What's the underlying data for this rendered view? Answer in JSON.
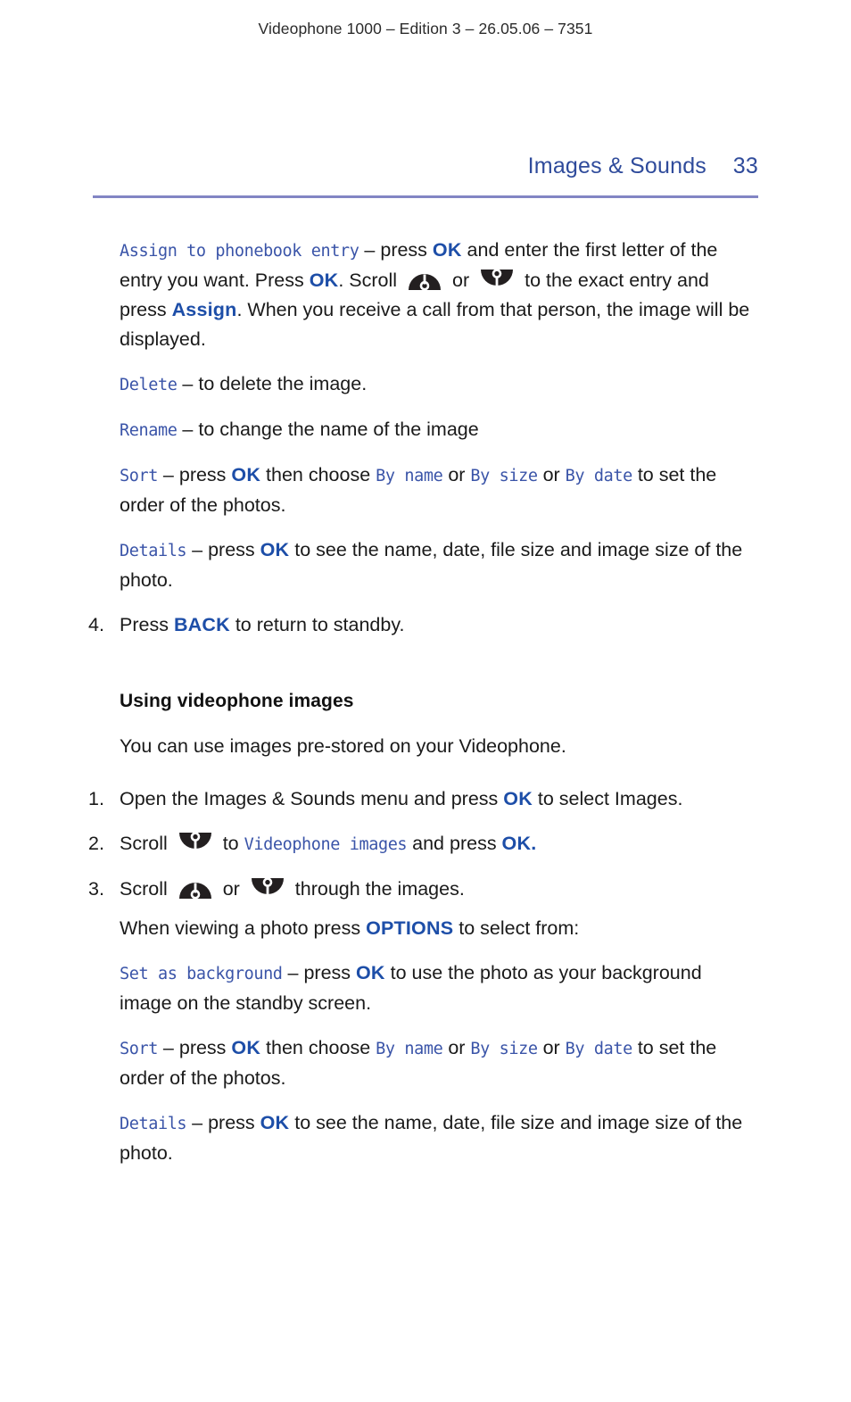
{
  "document": {
    "running_header": "Videophone 1000 – Edition 3 – 26.05.06 – 7351",
    "section_title": "Images & Sounds",
    "page_number": "33"
  },
  "colors": {
    "heading_blue": "#2f4b9b",
    "rule_blue": "#8285c4",
    "key_blue": "#1d4ea8",
    "lcd_blue": "#3a54a8",
    "body_text": "#1a1a1a"
  },
  "icons": {
    "scroll_up": "scroll-up-icon",
    "scroll_down": "scroll-down-icon"
  },
  "body": {
    "assign_entry": {
      "menu_label": "Assign to phonebook entry",
      "t1": " – press ",
      "key1": "OK",
      "t2": " and enter the first letter of the entry you want. Press ",
      "key2": "OK",
      "t3": ". Scroll ",
      "t4": " or ",
      "t5": " to the exact entry and press ",
      "key3": "Assign",
      "t6": ". When you receive a call from that person, the image will be displayed."
    },
    "delete": {
      "menu_label": "Delete",
      "t1": " – to delete the image."
    },
    "rename": {
      "menu_label": "Rename",
      "t1": " – to change the name of the image"
    },
    "sort_1": {
      "menu_label": "Sort",
      "t1": " – press ",
      "key1": "OK",
      "t2": " then choose ",
      "opt1": "By name",
      "t3": " or ",
      "opt2": "By size",
      "t4": " or ",
      "opt3": "By date",
      "t5": " to set the order of the photos."
    },
    "details_1": {
      "menu_label": "Details",
      "t1": " – press ",
      "key1": "OK",
      "t2": " to see the name, date, file size and image size of the photo."
    },
    "step4": {
      "number": "4.",
      "t1": "Press ",
      "key1": "BACK",
      "t2": " to return to standby."
    },
    "subheading": "Using videophone images",
    "intro": "You can use images pre-stored on your Videophone.",
    "step1": {
      "number": "1.",
      "t1": "Open the Images & Sounds menu and press ",
      "key1": "OK",
      "t2": " to select Images."
    },
    "step2": {
      "number": "2.",
      "t1": "Scroll ",
      "t2": " to ",
      "menu_label": "Videophone images",
      "t3": " and press ",
      "key1": "OK."
    },
    "step3": {
      "number": "3.",
      "t1": "Scroll ",
      "t2": " or ",
      "t3": " through the images."
    },
    "options_intro": {
      "t1": "When viewing a photo press ",
      "key1": "OPTIONS",
      "t2": " to select from:"
    },
    "set_background": {
      "menu_label": "Set as background",
      "t1": " – press ",
      "key1": "OK",
      "t2": " to use the photo as your background image on the standby screen."
    },
    "sort_2": {
      "menu_label": "Sort",
      "t1": " – press ",
      "key1": "OK",
      "t2": " then choose ",
      "opt1": "By name",
      "t3": " or ",
      "opt2": "By size",
      "t4": " or ",
      "opt3": "By date",
      "t5": " to set the order of the photos."
    },
    "details_2": {
      "menu_label": "Details",
      "t1": " – press ",
      "key1": "OK",
      "t2": " to see the name, date, file size and image size of the photo."
    }
  }
}
